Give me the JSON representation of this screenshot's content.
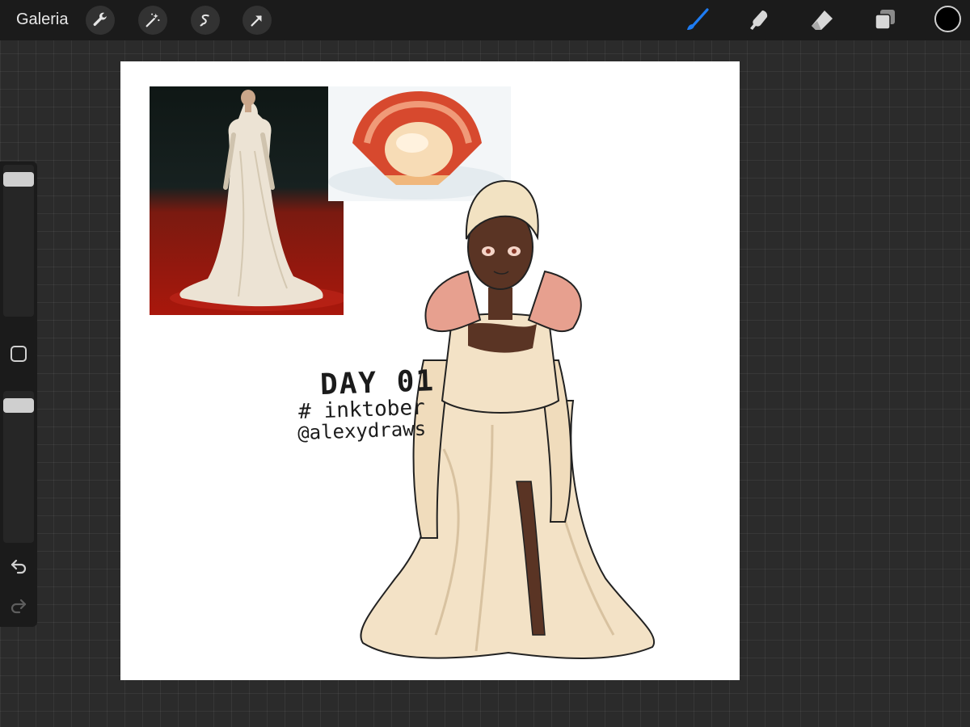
{
  "topbar": {
    "gallery_label": "Galeria",
    "tools_left": [
      "wrench-icon",
      "magic-wand-icon",
      "selection-icon",
      "transform-arrow-icon"
    ],
    "tools_right": [
      "brush-icon",
      "smudge-icon",
      "eraser-icon",
      "layers-icon"
    ],
    "active_tool": "brush",
    "accent_color": "#1e7cf2",
    "current_color": "#000000"
  },
  "sidebar": {
    "brush_size_level": 0.95,
    "opacity_level": 0.95,
    "icons": [
      "modify-square-icon",
      "undo-icon",
      "redo-icon"
    ]
  },
  "canvas": {
    "background": "#ffffff",
    "references": [
      "dress-reference-photo",
      "scallop-reference-photo"
    ],
    "text": {
      "day": "DAY 01",
      "hashtag": "# inktober",
      "handle": "@alexydraws"
    }
  }
}
